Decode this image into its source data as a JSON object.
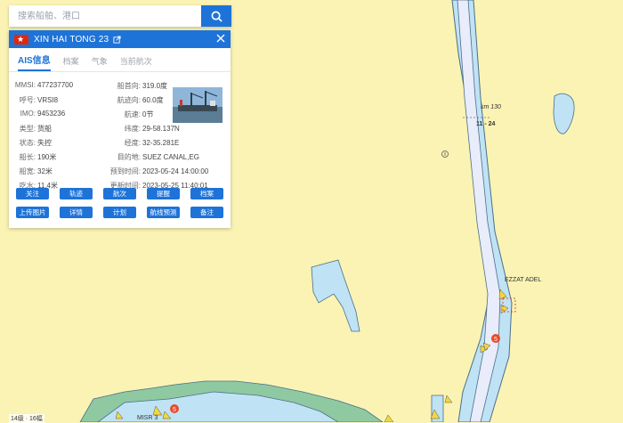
{
  "search": {
    "placeholder": "搜索船舶、港口",
    "icon": "search-icon"
  },
  "ship": {
    "name": "XIN HAI TONG 23",
    "flag_color": "#de2910",
    "tabs": [
      "AIS信息",
      "档案",
      "气象",
      "当前航次"
    ],
    "info_left": [
      {
        "k": "MMSI:",
        "v": "477237700"
      },
      {
        "k": "呼号:",
        "v": "VRSI8"
      },
      {
        "k": "IMO:",
        "v": "9453236"
      },
      {
        "k": "类型:",
        "v": "货船"
      },
      {
        "k": "状态:",
        "v": "失控"
      },
      {
        "k": "船长:",
        "v": "190米"
      },
      {
        "k": "船宽:",
        "v": "32米"
      },
      {
        "k": "吃水:",
        "v": "11.4米"
      }
    ],
    "info_right": [
      {
        "k": "船首向:",
        "v": "319.0度"
      },
      {
        "k": "航迹向:",
        "v": "60.0度"
      },
      {
        "k": "航速:",
        "v": "0节"
      },
      {
        "k": "纬度:",
        "v": "29-58.137N"
      },
      {
        "k": "经度:",
        "v": "32-35.281E"
      },
      {
        "k": "目的地:",
        "v": "SUEZ CANAL,EG"
      },
      {
        "k": "预到时间:",
        "v": "2023-05-24 14:00:00"
      },
      {
        "k": "更新时间:",
        "v": "2023-05-25 11:40:01"
      }
    ],
    "buttons_row1": [
      "关注",
      "轨迹",
      "航次",
      "提醒",
      "档案"
    ],
    "buttons_row2": [
      "上传图片",
      "详情",
      "计划",
      "航线预测",
      "备注"
    ]
  },
  "map": {
    "labels": {
      "ezzat": "EZZAT ADEL",
      "km": "km 130",
      "km_range": "11 - 24",
      "misr": "MISR 3"
    },
    "scale": "14级 · 16幅",
    "colors": {
      "land": "#faf3b4",
      "water": "#bfe3f5",
      "channel": "#dde7f7",
      "green": "#8fc9a2",
      "accent": "#1e73d8"
    }
  }
}
